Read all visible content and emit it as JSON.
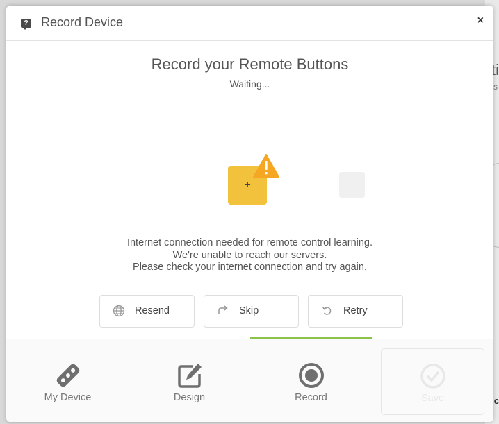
{
  "dialog": {
    "title": "Record Device",
    "title_icon": "help-icon",
    "close_label": "×"
  },
  "main": {
    "heading": "Record your Remote Buttons",
    "status": "Waiting...",
    "add_tile_label": "+",
    "remove_tile_label": "−",
    "message_lines": [
      "Internet connection needed for remote control learning.",
      "We're unable to reach our servers.",
      "Please check your internet connection and try again."
    ],
    "actions": [
      {
        "label": "Resend",
        "icon": "globe-icon"
      },
      {
        "label": "Skip",
        "icon": "redo-arrow-icon"
      },
      {
        "label": "Retry",
        "icon": "undo-icon"
      }
    ]
  },
  "footer": {
    "tabs": [
      {
        "label": "My Device",
        "icon": "remote-icon"
      },
      {
        "label": "Design",
        "icon": "edit-icon"
      },
      {
        "label": "Record",
        "icon": "record-icon",
        "active": true
      }
    ],
    "save": {
      "label": "Save",
      "icon": "check-circle-icon",
      "disabled": true
    }
  },
  "colors": {
    "accent": "#8bc34a",
    "tile_yellow": "#f3c23d",
    "warning": "#f5a623"
  }
}
